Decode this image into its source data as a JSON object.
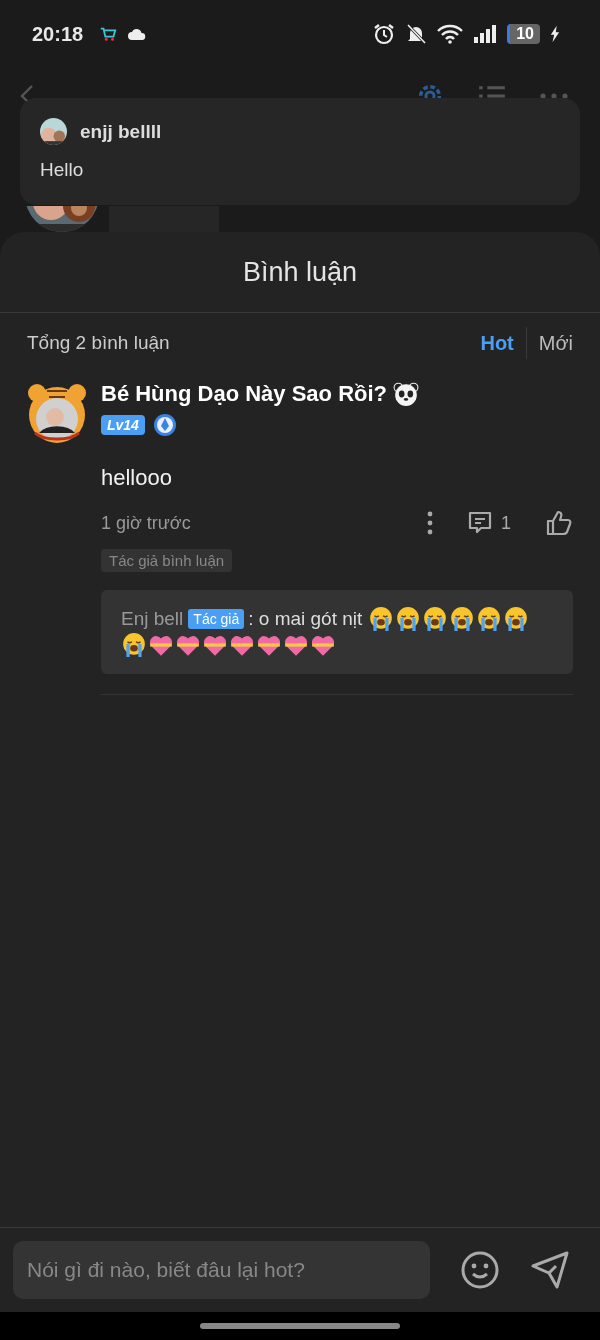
{
  "status_bar": {
    "time": "20:18",
    "battery": "10"
  },
  "notification": {
    "sender": "enjj bellll",
    "message": "Hello"
  },
  "sheet": {
    "title": "Bình luận",
    "total": "Tổng 2 bình luận",
    "sort_tabs": [
      {
        "label": "Hot",
        "selected": true
      },
      {
        "label": "Mới",
        "selected": false
      }
    ],
    "comments": [
      {
        "author": "Bé Hùng Dạo Này Sao Rồi?",
        "level": "Lv14",
        "text": "hellooo",
        "time": "1 giờ trước",
        "reply_count": "1",
        "liked": false,
        "tag": "Tác giả bình luận",
        "replies": [
          {
            "author": "Enj bell",
            "badge": "Tác giả",
            "text": ": o mai gót nịt",
            "emojis": [
              {
                "kind": "crying"
              },
              {
                "kind": "crying"
              },
              {
                "kind": "crying"
              },
              {
                "kind": "crying"
              },
              {
                "kind": "crying"
              },
              {
                "kind": "crying"
              },
              {
                "kind": "crying"
              },
              {
                "kind": "heart"
              },
              {
                "kind": "heart"
              },
              {
                "kind": "heart"
              },
              {
                "kind": "heart"
              },
              {
                "kind": "heart"
              },
              {
                "kind": "heart"
              },
              {
                "kind": "heart"
              }
            ]
          }
        ]
      }
    ]
  },
  "composer": {
    "placeholder": "Nói gì đi nào, biết đâu lại hot?"
  }
}
